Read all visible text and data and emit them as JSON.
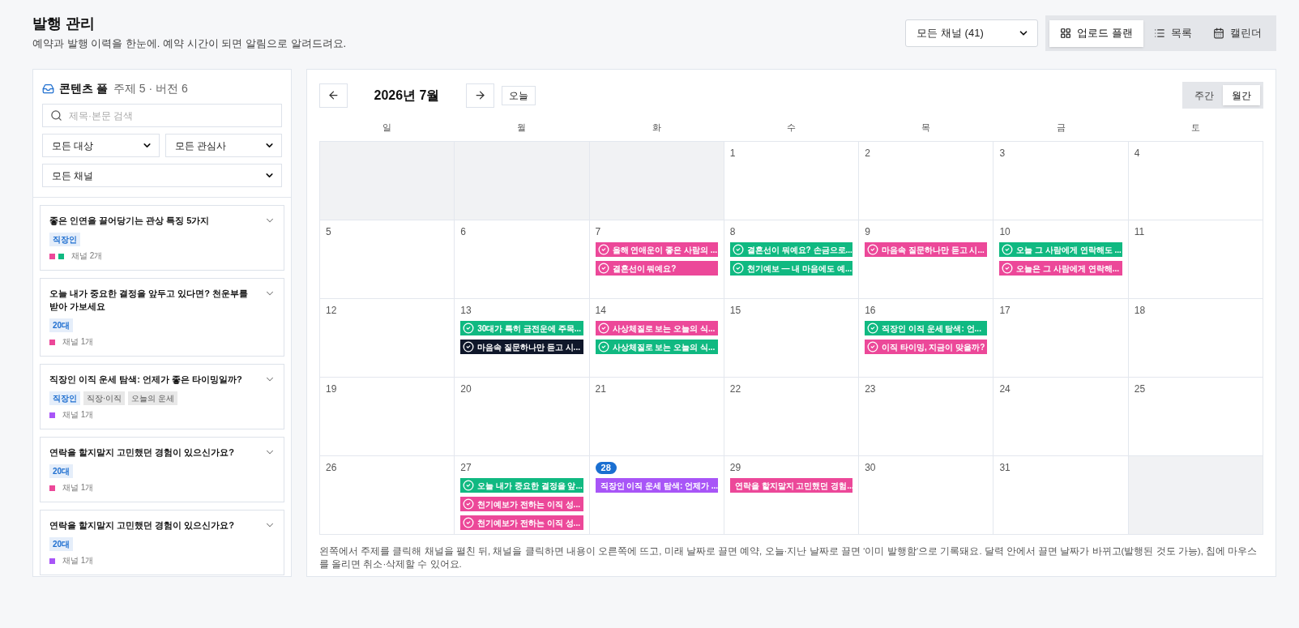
{
  "header": {
    "title": "발행 관리",
    "subtitle": "예약과 발행 이력을 한눈에. 예약 시간이 되면 알림으로 알려드려요."
  },
  "channel_filter": {
    "value": "모든 채널 (41)"
  },
  "view_tabs": [
    {
      "label": "업로드 플랜",
      "selected": true
    },
    {
      "label": "목록",
      "selected": false
    },
    {
      "label": "캘린더",
      "selected": false
    }
  ],
  "content_pool": {
    "title": "콘텐츠 풀",
    "summary": "주제 5 · 버전 6",
    "search": {
      "placeholder": "제목·본문 검색"
    },
    "filters": [
      {
        "value": "모든 대상"
      },
      {
        "value": "모든 관심사"
      },
      {
        "value": "모든 채널"
      }
    ],
    "topics": [
      {
        "title": "좋은 인연을 끌어당기는 관상 특징 5가지",
        "expanded": false,
        "tags": [
          {
            "label": "직장인",
            "kind": "target"
          }
        ],
        "channels": [
          {
            "color": "#ec4899"
          },
          {
            "color": "#10b981"
          }
        ],
        "channel_count": "채널 2개"
      },
      {
        "title": "오늘 내가 중요한 결정을 앞두고 있다면? 천운부를 받아 가보세요",
        "expanded": false,
        "tags": [
          {
            "label": "20대",
            "kind": "target"
          }
        ],
        "channels": [
          {
            "color": "#ec4899"
          }
        ],
        "channel_count": "채널 1개"
      },
      {
        "title": "직장인 이직 운세 탐색: 언제가 좋은 타이밍일까?",
        "expanded": false,
        "tags": [
          {
            "label": "직장인",
            "kind": "target"
          },
          {
            "label": "직장·이직",
            "kind": "topic"
          },
          {
            "label": "오늘의 운세",
            "kind": "topic"
          }
        ],
        "channels": [
          {
            "color": "#a855f7"
          }
        ],
        "channel_count": "채널 1개"
      },
      {
        "title": "연락을 할지말지 고민했던 경험이 있으신가요?",
        "expanded": false,
        "tags": [
          {
            "label": "20대",
            "kind": "target"
          }
        ],
        "channels": [
          {
            "color": "#ec4899"
          }
        ],
        "channel_count": "채널 1개"
      },
      {
        "title": "연락을 할지말지 고민했던 경험이 있으신가요?",
        "expanded": false,
        "tags": [
          {
            "label": "20대",
            "kind": "target"
          }
        ],
        "channels": [
          {
            "color": "#a855f7"
          }
        ],
        "channel_count": "채널 1개"
      }
    ]
  },
  "calendar": {
    "month": "2026년 7월",
    "today_button": "오늘",
    "view_modes": [
      {
        "label": "주간",
        "selected": false
      },
      {
        "label": "월간",
        "selected": true
      }
    ],
    "weekdays": [
      "일",
      "월",
      "화",
      "수",
      "목",
      "금",
      "토"
    ],
    "weeks": [
      [
        {
          "outside": true
        },
        {
          "outside": true
        },
        {
          "outside": true
        },
        {
          "day": "1",
          "outside": false,
          "today": false
        },
        {
          "day": "2",
          "outside": false,
          "today": false
        },
        {
          "day": "3",
          "outside": false,
          "today": false
        },
        {
          "day": "4",
          "outside": false,
          "today": false
        }
      ],
      [
        {
          "day": "5",
          "outside": false,
          "today": false
        },
        {
          "day": "6",
          "outside": false,
          "today": false
        },
        {
          "day": "7",
          "outside": false,
          "today": false,
          "events": [
            {
              "title": "올해 연애운이 좋은 사람의 ...",
              "color": "#ec4899",
              "published": true
            },
            {
              "title": "결혼선이 뭐예요?",
              "color": "#ec4899",
              "published": true
            }
          ]
        },
        {
          "day": "8",
          "outside": false,
          "today": false,
          "events": [
            {
              "title": "결혼선이 뭐예요? 손금으로...",
              "color": "#10b981",
              "published": true
            },
            {
              "title": "천기예보 — 내 마음에도 예...",
              "color": "#10b981",
              "published": true
            }
          ]
        },
        {
          "day": "9",
          "outside": false,
          "today": false,
          "events": [
            {
              "title": "마음속 질문하나만 듣고 시...",
              "color": "#ec4899",
              "published": true
            }
          ]
        },
        {
          "day": "10",
          "outside": false,
          "today": false,
          "events": [
            {
              "title": "오늘 그 사람에게 연락해도 ...",
              "color": "#10b981",
              "published": true
            },
            {
              "title": "오늘은 그 사람에게 연락해...",
              "color": "#ec4899",
              "published": true
            }
          ]
        },
        {
          "day": "11",
          "outside": false,
          "today": false
        }
      ],
      [
        {
          "day": "12",
          "outside": false,
          "today": false
        },
        {
          "day": "13",
          "outside": false,
          "today": false,
          "events": [
            {
              "title": "30대가 특히 금전운에 주목...",
              "color": "#10b981",
              "published": true
            },
            {
              "title": "마음속 질문하나만 듣고 시...",
              "color": "#0f172a",
              "published": true
            }
          ]
        },
        {
          "day": "14",
          "outside": false,
          "today": false,
          "events": [
            {
              "title": "사상체질로 보는 오늘의 식...",
              "color": "#ec4899",
              "published": true
            },
            {
              "title": "사상체질로 보는 오늘의 식...",
              "color": "#10b981",
              "published": true
            }
          ]
        },
        {
          "day": "15",
          "outside": false,
          "today": false
        },
        {
          "day": "16",
          "outside": false,
          "today": false,
          "events": [
            {
              "title": "직장인 이직 운세 탐색: 언...",
              "color": "#10b981",
              "published": true
            },
            {
              "title": "이직 타이밍, 지금이 맞을까?",
              "color": "#ec4899",
              "published": true
            }
          ]
        },
        {
          "day": "17",
          "outside": false,
          "today": false
        },
        {
          "day": "18",
          "outside": false,
          "today": false
        }
      ],
      [
        {
          "day": "19",
          "outside": false,
          "today": false
        },
        {
          "day": "20",
          "outside": false,
          "today": false
        },
        {
          "day": "21",
          "outside": false,
          "today": false
        },
        {
          "day": "22",
          "outside": false,
          "today": false
        },
        {
          "day": "23",
          "outside": false,
          "today": false
        },
        {
          "day": "24",
          "outside": false,
          "today": false
        },
        {
          "day": "25",
          "outside": false,
          "today": false
        }
      ],
      [
        {
          "day": "26",
          "outside": false,
          "today": false
        },
        {
          "day": "27",
          "outside": false,
          "today": false,
          "events": [
            {
              "title": "오늘 내가 중요한 결정을 앞...",
              "color": "#10b981",
              "published": true
            },
            {
              "title": "천기예보가 전하는 이직 성...",
              "color": "#ec4899",
              "published": true
            },
            {
              "title": "천기예보가 전하는 이직 성...",
              "color": "#ec4899",
              "published": true
            }
          ]
        },
        {
          "day": "28",
          "outside": false,
          "today": true,
          "events": [
            {
              "title": "직장인 이직 운세 탐색: 언제가 ...",
              "color": "#a855f7",
              "published": false
            }
          ]
        },
        {
          "day": "29",
          "outside": false,
          "today": false,
          "events": [
            {
              "title": "연락을 할지말지 고민했던 경험...",
              "color": "#ec4899",
              "published": false
            }
          ]
        },
        {
          "day": "30",
          "outside": false,
          "today": false
        },
        {
          "day": "31",
          "outside": false,
          "today": false
        },
        {
          "outside": true
        }
      ]
    ],
    "hint": "왼쪽에서 주제를 클릭해 채널을 펼친 뒤, 채널을 클릭하면 내용이 오른쪽에 뜨고, 미래 날짜로 끌면 예약, 오늘·지난 날짜로 끌면 ‘이미 발행함’으로 기록돼요. 달력 안에서 끌면 날짜가 바뀌고(발행된 것도 가능), 칩에 마우스를 올리면 취소·삭제할 수 있어요."
  }
}
